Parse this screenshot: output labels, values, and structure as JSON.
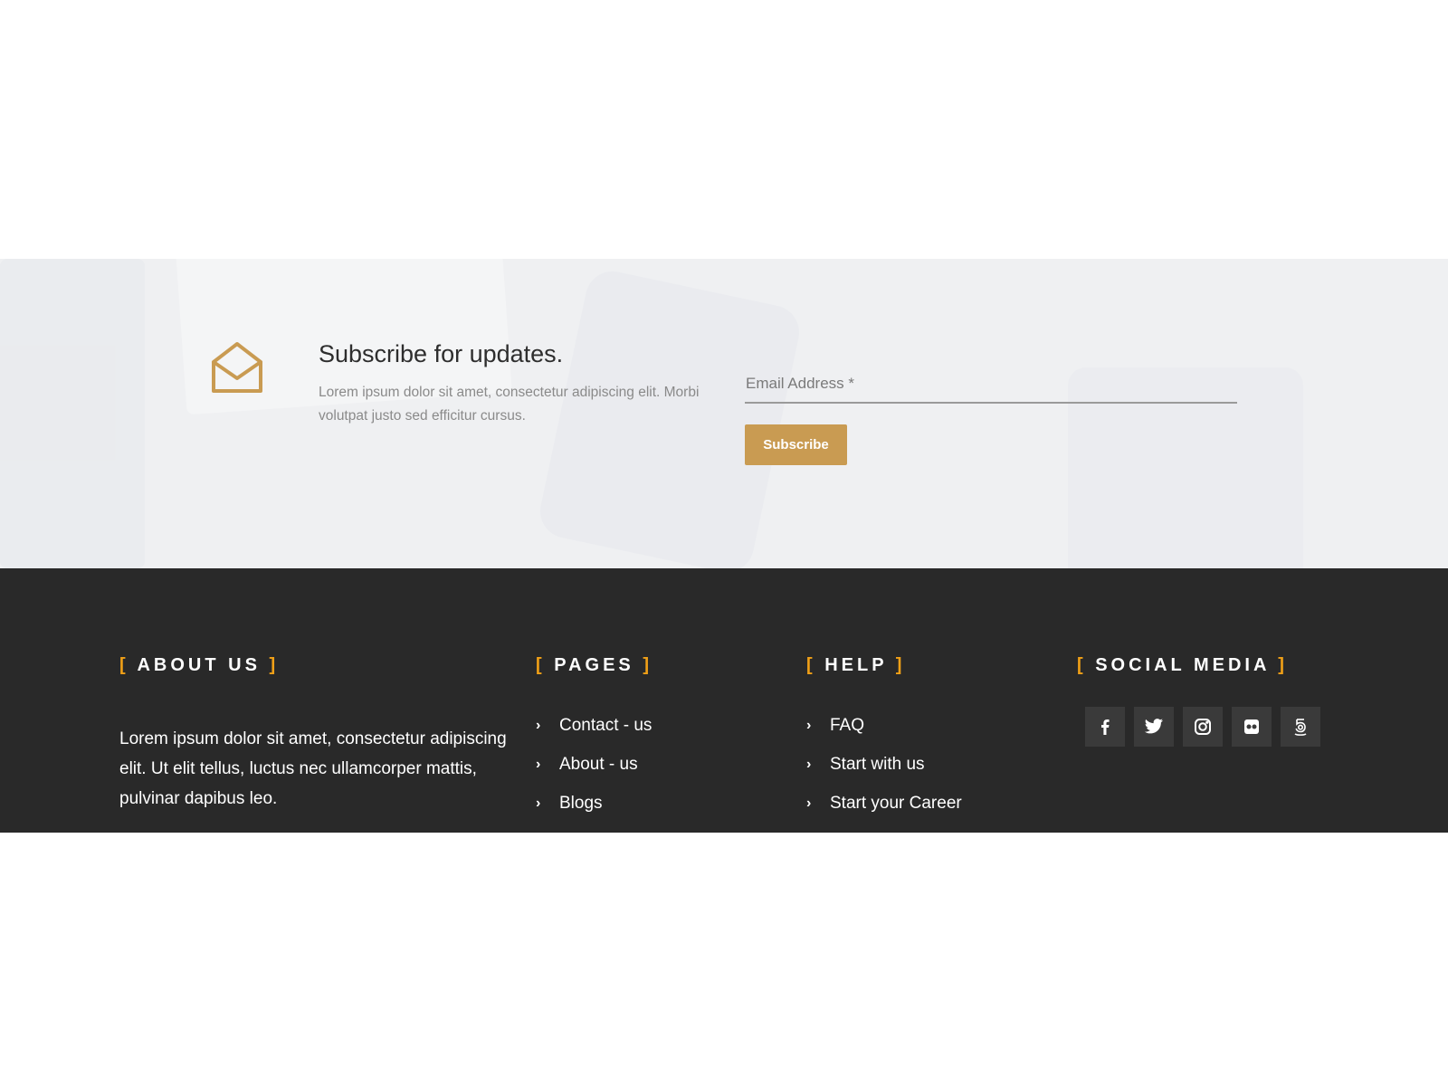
{
  "subscribe": {
    "title": "Subscribe for updates.",
    "description": "Lorem ipsum dolor sit amet, consectetur adipiscing elit. Morbi volutpat justo sed efficitur cursus.",
    "email_placeholder": "Email Address *",
    "button_label": "Subscribe",
    "accent_color": "#c99b52",
    "icon": "envelope-open-icon"
  },
  "footer": {
    "background_color": "#292929",
    "bracket_color": "#f0a017",
    "about": {
      "heading": "ABOUT US",
      "text": "Lorem ipsum dolor sit amet, consectetur adipiscing elit. Ut elit tellus, luctus nec ullamcorper mattis, pulvinar dapibus leo."
    },
    "pages": {
      "heading": "PAGES",
      "links": [
        "Contact - us",
        "About - us",
        "Blogs"
      ]
    },
    "help": {
      "heading": "HELP",
      "links": [
        "FAQ",
        "Start with us",
        "Start your Career"
      ]
    },
    "social": {
      "heading": "SOCIAL MEDIA",
      "icons": [
        "facebook-icon",
        "twitter-icon",
        "instagram-icon",
        "flickr-icon",
        "500px-icon"
      ]
    }
  }
}
